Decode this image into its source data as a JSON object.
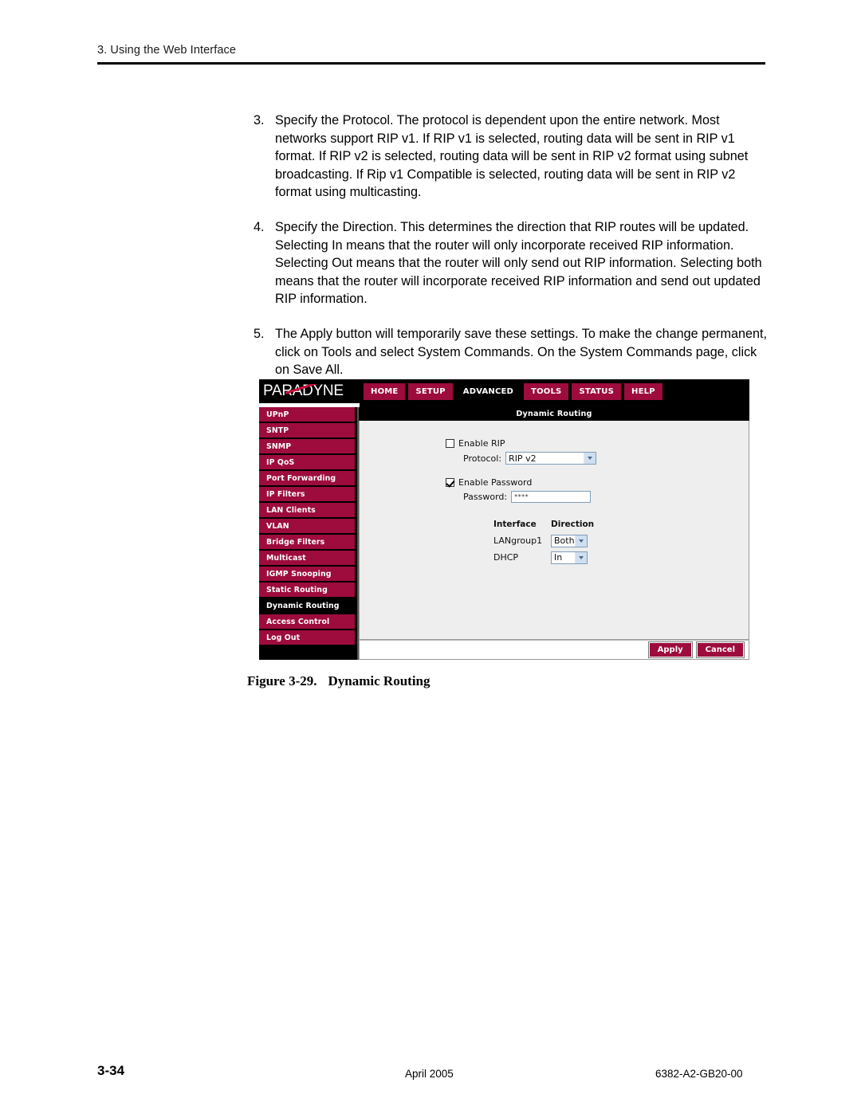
{
  "page": {
    "running_head": "3. Using the Web Interface",
    "footer": {
      "page_number": "3-34",
      "date": "April 2005",
      "document_id": "6382-A2-GB20-00"
    }
  },
  "steps": [
    {
      "number": "3.",
      "text": "Specify the Protocol. The protocol is dependent upon the entire network. Most networks support RIP v1. If RIP v1 is selected, routing data will be sent in RIP v1 format. If RIP v2 is selected, routing data will be sent in RIP v2 format using subnet broadcasting. If Rip v1 Compatible is selected, routing data will be sent in RIP v2 format using multicasting."
    },
    {
      "number": "4.",
      "text": "Specify the Direction. This determines the direction that RIP routes will be updated. Selecting In means that the router will only incorporate received RIP information. Selecting Out means that the router will only send out RIP information. Selecting both means that the router will incorporate received RIP information and send out updated RIP information."
    },
    {
      "number": "5.",
      "text": "The Apply button will temporarily save these settings. To make the change permanent, click on Tools and select System Commands. On the System Commands page, click on Save All."
    }
  ],
  "figure": {
    "caption_label": "Figure 3-29.",
    "caption_title": "Dynamic Routing",
    "brand": "PARADYNE",
    "nav": [
      {
        "label": "HOME",
        "active": false
      },
      {
        "label": "SETUP",
        "active": false
      },
      {
        "label": "ADVANCED",
        "active": true
      },
      {
        "label": "TOOLS",
        "active": false
      },
      {
        "label": "STATUS",
        "active": false
      },
      {
        "label": "HELP",
        "active": false
      }
    ],
    "sidebar": [
      {
        "label": "UPnP",
        "selected": false
      },
      {
        "label": "SNTP",
        "selected": false
      },
      {
        "label": "SNMP",
        "selected": false
      },
      {
        "label": "IP QoS",
        "selected": false
      },
      {
        "label": "Port Forwarding",
        "selected": false
      },
      {
        "label": "IP Filters",
        "selected": false
      },
      {
        "label": "LAN Clients",
        "selected": false
      },
      {
        "label": "VLAN",
        "selected": false
      },
      {
        "label": "Bridge Filters",
        "selected": false
      },
      {
        "label": "Multicast",
        "selected": false
      },
      {
        "label": "IGMP Snooping",
        "selected": false
      },
      {
        "label": "Static Routing",
        "selected": false
      },
      {
        "label": "Dynamic Routing",
        "selected": true
      },
      {
        "label": "Access Control",
        "selected": false
      },
      {
        "label": "Log Out",
        "selected": false
      }
    ],
    "content_title": "Dynamic Routing",
    "form": {
      "enable_rip_label": "Enable RIP",
      "enable_rip_checked": false,
      "protocol_label": "Protocol:",
      "protocol_value": "RIP v2",
      "enable_password_label": "Enable Password",
      "enable_password_checked": true,
      "password_label": "Password:",
      "password_value": "****",
      "table": {
        "header_interface": "Interface",
        "header_direction": "Direction",
        "rows": [
          {
            "interface": "LANgroup1",
            "direction": "Both"
          },
          {
            "interface": "DHCP",
            "direction": "In"
          }
        ]
      }
    },
    "buttons": {
      "apply": "Apply",
      "cancel": "Cancel"
    },
    "colors": {
      "brand_red": "#9d0c3c",
      "bar_black": "#000000",
      "panel_gray": "#eeeeee"
    }
  }
}
